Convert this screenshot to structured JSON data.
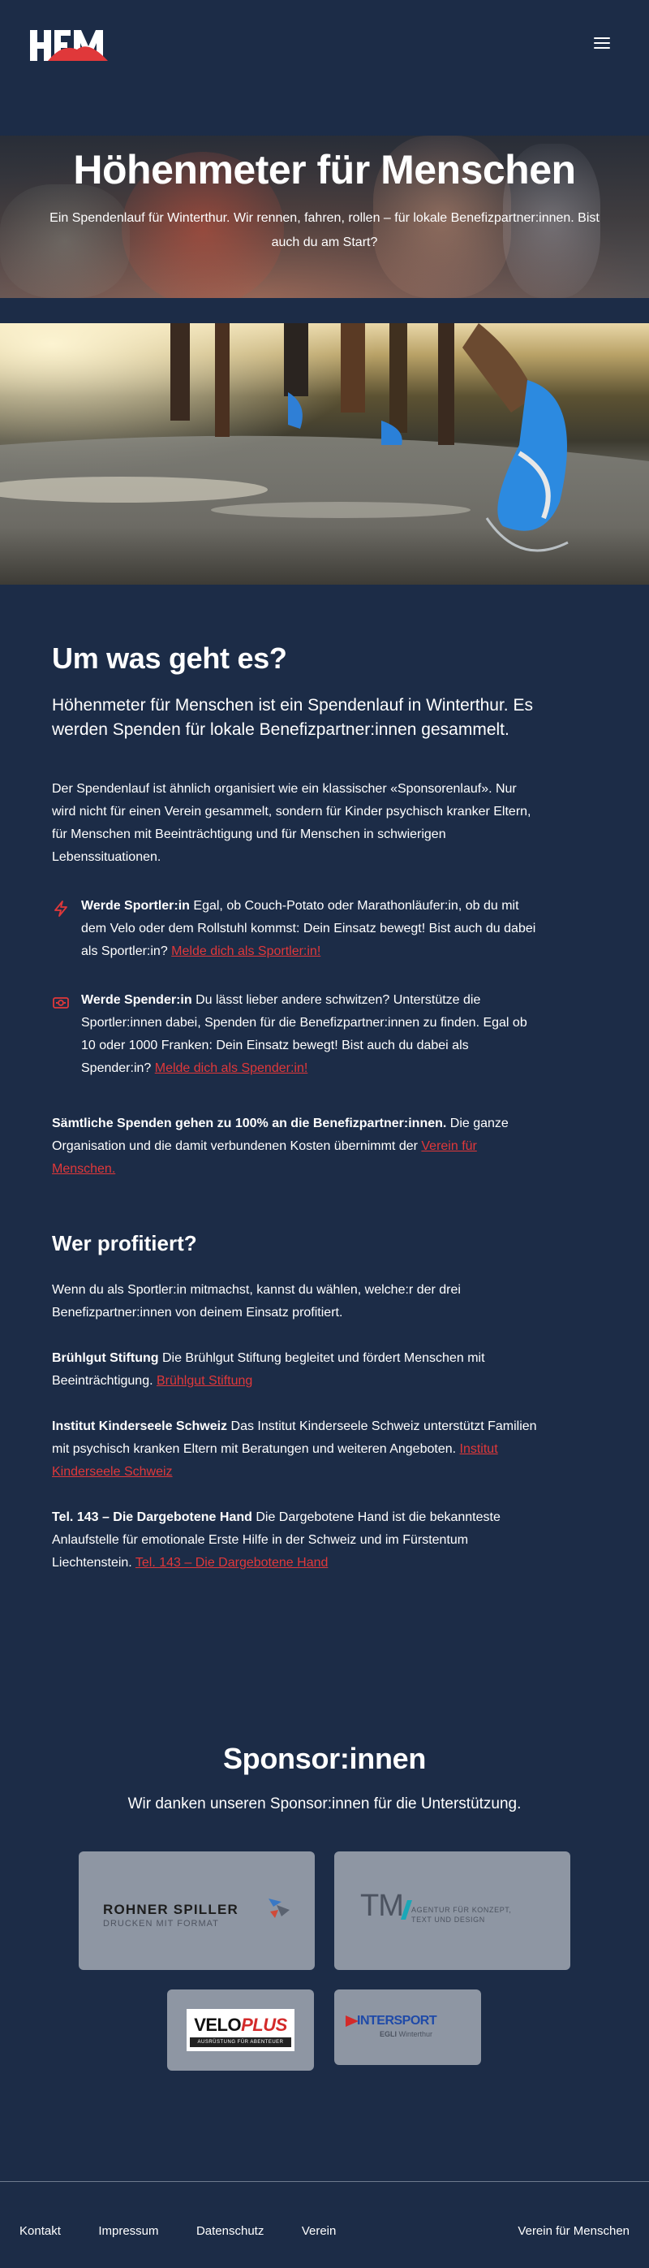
{
  "header": {
    "logo_alt": "HfM",
    "logo_icon": "hfm-logo",
    "menu_icon": "hamburger-icon"
  },
  "hero": {
    "title": "Höhenmeter für Menschen",
    "subtitle": "Ein Spendenlauf für Winterthur. Wir rennen, fahren, rollen – für lokale Benefizpartner:innen. Bist auch du am Start?"
  },
  "about": {
    "heading": "Um was geht es?",
    "lead": "Höhenmeter für Menschen ist ein Spendenlauf in Winterthur. Es werden Spenden für lokale Benefizpartner:innen gesammelt.",
    "paragraph": "Der Spendenlauf ist ähnlich organisiert wie ein klassischer «Sponsorenlauf». Nur wird nicht für einen Verein gesammelt, sondern für Kinder psychisch kranker Eltern, für Menschen mit Beeinträchtigung und für Menschen in schwierigen Lebenssituationen.",
    "features": [
      {
        "icon": "lightning-icon",
        "title": "Werde Sportler:in",
        "text": " Egal, ob Couch-Potato oder Marathonläufer:in, ob du mit dem Velo oder dem Rollstuhl kommst: Dein Einsatz bewegt! Bist auch du dabei als Sportler:in? ",
        "link": "Melde dich als Sportler:in!"
      },
      {
        "icon": "money-icon",
        "title": "Werde Spender:in",
        "text": " Du lässt lieber andere schwitzen? Unterstütze die Sportler:innen dabei, Spenden für die Benefizpartner:innen zu finden. Egal ob 10 oder 1000 Franken: Dein Einsatz bewegt! Bist auch du dabei als Spender:in? ",
        "link": "Melde dich als Spender:in!"
      }
    ],
    "note_bold": "Sämtliche Spenden gehen zu 100% an die Benefizpartner:innen.",
    "note_text": " Die ganze Organisation und die damit verbundenen Kosten übernimmt der ",
    "note_link": "Verein für Menschen."
  },
  "beneficiaries": {
    "heading": "Wer profitiert?",
    "intro": "Wenn du als Sportler:in mitmachst, kannst du wählen, welche:r der drei Benefizpartner:innen von deinem Einsatz profitiert.",
    "items": [
      {
        "name": "Brühlgut Stiftung",
        "text": " Die Brühlgut Stiftung begleitet und fördert Menschen mit Beeinträchtigung. ",
        "link": "Brühlgut Stiftung"
      },
      {
        "name": "Institut Kinderseele Schweiz",
        "text": " Das Institut Kinderseele Schweiz unterstützt Familien mit psychisch kranken Eltern mit Beratungen und weiteren Angeboten. ",
        "link": "Institut Kinderseele Schweiz"
      },
      {
        "name": "Tel. 143 – Die Dargebotene Hand",
        "text": " Die Dargebotene Hand ist die bekannteste Anlaufstelle für emotionale Erste Hilfe in der Schweiz und im Fürstentum Liechtenstein. ",
        "link": "Tel. 143 – Die Dargebotene Hand"
      }
    ]
  },
  "sponsors": {
    "heading": "Sponsor:innen",
    "subtitle": "Wir danken unseren Sponsor:innen für die Unterstützung.",
    "rohner": {
      "name": "ROHNER SPILLER",
      "tagline": "DRUCKEN MIT FORMAT"
    },
    "tm": {
      "name": "TM",
      "tagline_1": "AGENTUR FÜR KONZEPT,",
      "tagline_2": "TEXT UND DESIGN"
    },
    "veloplus": {
      "name_a": "VELO",
      "name_b": "PLUS",
      "tagline": "AUSRÜSTUNG FÜR ABENTEUER"
    },
    "intersport": {
      "name": "INTERSPORT",
      "sub_a": "EGLI",
      "sub_b": " Winterthur"
    }
  },
  "footer": {
    "links": [
      "Kontakt",
      "Impressum",
      "Datenschutz",
      "Verein"
    ],
    "org": "Verein für Menschen"
  },
  "colors": {
    "background": "#1c2c47",
    "accent": "#e0383a",
    "text": "#ffffff"
  }
}
